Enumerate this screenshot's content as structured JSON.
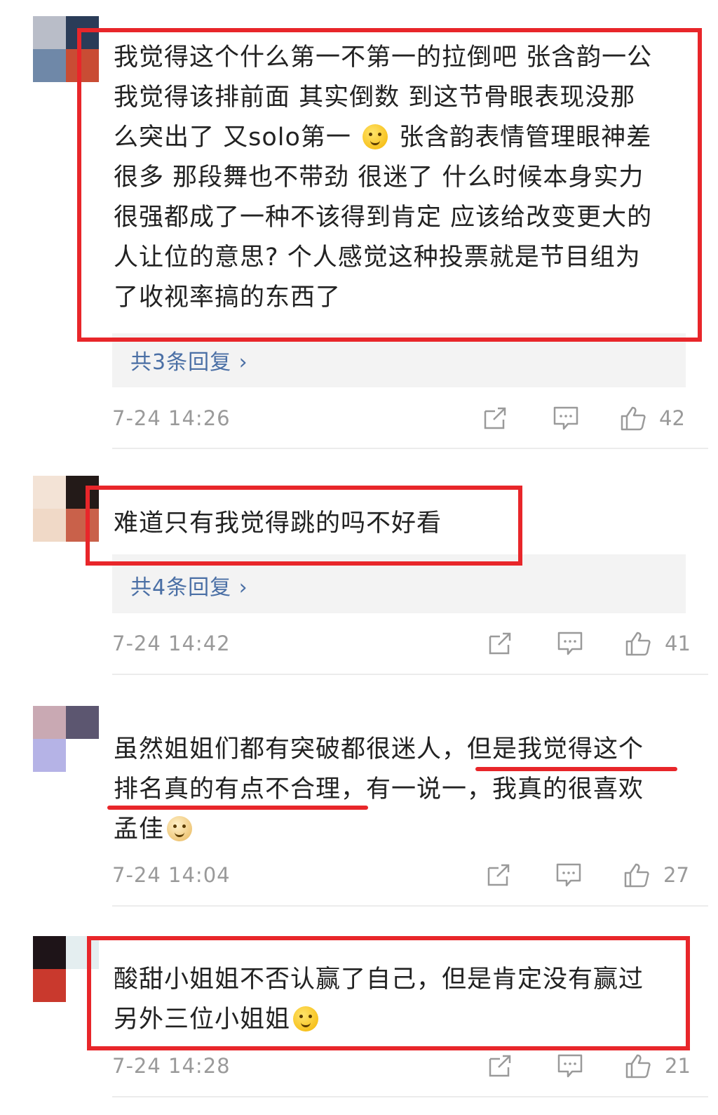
{
  "comments": [
    {
      "avatar_colors": [
        "#b9bdc8",
        "#2a3c58",
        "#6f88a8",
        "#c94c34"
      ],
      "lines": [
        "我觉得这个什么第一不第一的拉倒吧 张含韵一公",
        "我觉得该排前面 其实倒数 到这节骨眼表现没那",
        "么突出了 又solo第一",
        " 张含韵表情管理眼神差",
        "很多 那段舞也不带劲 很迷了 什么时候本身实力",
        "很强都成了一种不该得到肯定 应该给改变更大的",
        "人让位的意思? 个人感觉这种投票就是节目组为",
        "了收视率搞的东西了"
      ],
      "emoji_name": "smirk-emoji",
      "replies_label": "共3条回复 ›",
      "time": "7-24 14:26",
      "likes": "42"
    },
    {
      "avatar_colors": [
        "#f3e3d6",
        "#231a18",
        "#f0d9c7",
        "#c9614a"
      ],
      "lines": [
        "难道只有我觉得跳的吗不好看"
      ],
      "replies_label": "共4条回复 ›",
      "time": "7-24 14:42",
      "likes": "41"
    },
    {
      "avatar_colors": [
        "#c9a9b3",
        "#5c5670",
        "#b5b3e6",
        "#ffffff"
      ],
      "lines": [
        "虽然姐姐们都有突破都很迷人，但是我觉得这个",
        "排名真的有点不合理，有一说一，我真的很喜欢",
        "孟佳"
      ],
      "emoji_name": "doge-emoji",
      "time": "7-24 14:04",
      "likes": "27"
    },
    {
      "avatar_colors": [
        "#1e1418",
        "#e4eef0",
        "#c9392d",
        "#ffffff"
      ],
      "lines": [
        "酸甜小姐姐不否认赢了自己，但是肯定没有赢过",
        "另外三位小姐姐"
      ],
      "emoji_name": "smile-emoji",
      "time": "7-24 14:28",
      "likes": "21"
    }
  ],
  "icons": {
    "share": "share-icon",
    "comment": "comment-icon",
    "like": "thumbs-up-icon"
  },
  "colors": {
    "highlight": "#e8262a",
    "reply_link": "#4a6fa5",
    "meta_text": "#9a9a9a"
  }
}
